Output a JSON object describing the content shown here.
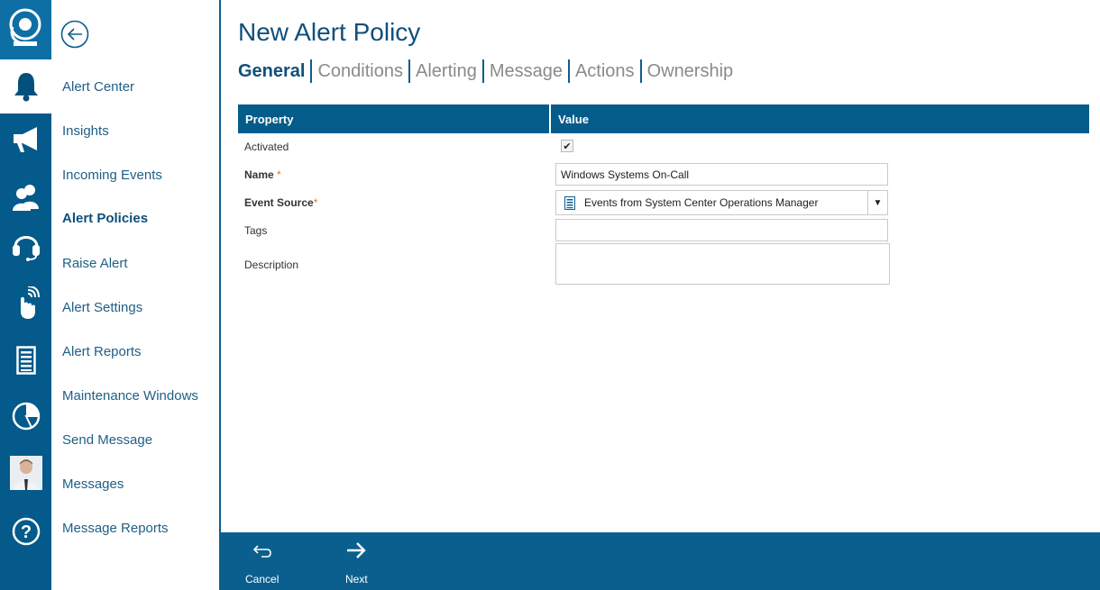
{
  "page": {
    "title": "New Alert Policy"
  },
  "tabs": [
    {
      "label": "General",
      "active": true
    },
    {
      "label": "Conditions"
    },
    {
      "label": "Alerting"
    },
    {
      "label": "Message"
    },
    {
      "label": "Actions"
    },
    {
      "label": "Ownership"
    }
  ],
  "rail": {
    "icons": [
      "logo-icon",
      "bell-icon",
      "megaphone-icon",
      "users-icon",
      "headset-icon",
      "touch-wave-icon",
      "document-icon",
      "pie-chart-icon",
      "user-avatar",
      "help-icon"
    ]
  },
  "menu": {
    "items": [
      {
        "label": "Alert Center"
      },
      {
        "label": "Insights"
      },
      {
        "label": "Incoming Events"
      },
      {
        "label": "Alert Policies",
        "active": true
      },
      {
        "label": "Raise Alert"
      },
      {
        "label": "Alert Settings"
      },
      {
        "label": "Alert Reports"
      },
      {
        "label": "Maintenance Windows"
      },
      {
        "label": "Send Message"
      },
      {
        "label": "Messages"
      },
      {
        "label": "Message Reports"
      }
    ]
  },
  "grid": {
    "headers": {
      "property": "Property",
      "value": "Value"
    },
    "rows": {
      "activated": {
        "label": "Activated",
        "checked": true
      },
      "name": {
        "label": "Name",
        "required_mark": "*",
        "value": "Windows Systems On-Call"
      },
      "event_source": {
        "label": "Event Source",
        "required_mark": "*",
        "value": "Events from System Center Operations Manager"
      },
      "tags": {
        "label": "Tags",
        "value": ""
      },
      "description": {
        "label": "Description",
        "value": ""
      }
    }
  },
  "footer": {
    "cancel_label": "Cancel",
    "next_label": "Next"
  },
  "colors": {
    "brand": "#045a8a",
    "header": "#045c8b",
    "footer": "#0b5f8e",
    "required": "#e07a1a"
  }
}
